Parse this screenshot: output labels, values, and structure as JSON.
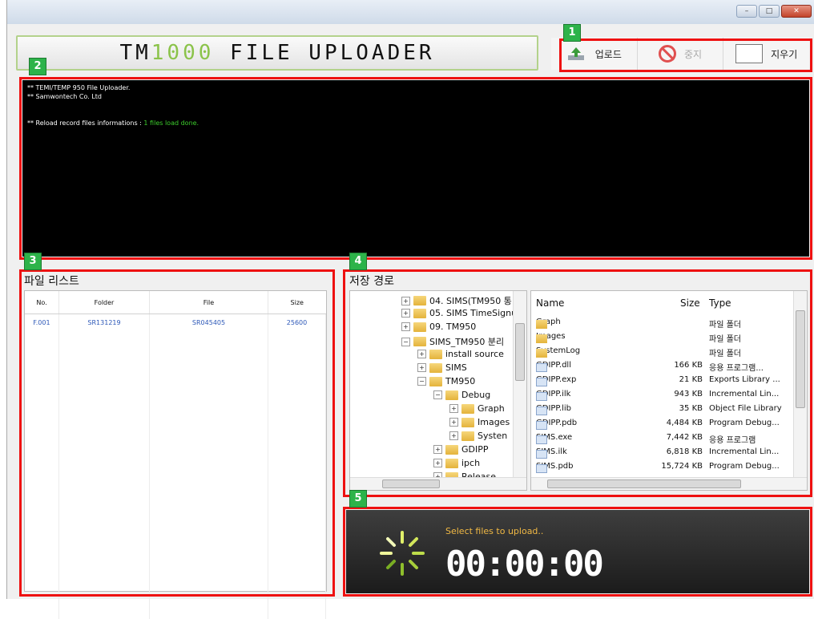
{
  "window": {
    "min": "–",
    "max": "□",
    "close": "✕"
  },
  "logo": {
    "part1": "TM",
    "part2": "1000",
    "part3": " FILE UPLOADER"
  },
  "toolbar": {
    "upload": "업로드",
    "stop": "중지",
    "clear": "지우기"
  },
  "badges": [
    "1",
    "2",
    "3",
    "4",
    "5"
  ],
  "console": {
    "line1": "** TEMI/TEMP 950 File Uploader.",
    "line2": "** Samwontech Co. Ltd",
    "line3_prefix": "** Reload record files informations : ",
    "line3_status": "1 files load done."
  },
  "filelist": {
    "title": "파일 리스트",
    "columns": [
      "No.",
      "Folder",
      "File",
      "Size"
    ],
    "rows": [
      [
        "F.001",
        "SR131219",
        "SR045405",
        "25600"
      ]
    ]
  },
  "save_path": {
    "title": "저장 경로",
    "tree": [
      "04. SIMS(TM950 통",
      "05. SIMS TimeSignu",
      "09. TM950",
      "SIMS_TM950 분리",
      "install source",
      "SIMS",
      "TM950",
      "Debug",
      "Graph",
      "Images",
      "Systen",
      "GDIPP",
      "ipch",
      "Release"
    ],
    "file_headers": {
      "name": "Name",
      "size": "Size",
      "type": "Type"
    },
    "files": [
      {
        "name": "Graph",
        "size": "",
        "type": "파일 폴더",
        "folder": true
      },
      {
        "name": "Images",
        "size": "",
        "type": "파일 폴더",
        "folder": true
      },
      {
        "name": "SystemLog",
        "size": "",
        "type": "파일 폴더",
        "folder": true
      },
      {
        "name": "GDIPP.dll",
        "size": "166 KB",
        "type": "응용 프로그램...",
        "folder": false
      },
      {
        "name": "GDIPP.exp",
        "size": "21 KB",
        "type": "Exports Library ...",
        "folder": false
      },
      {
        "name": "GDIPP.ilk",
        "size": "943 KB",
        "type": "Incremental Lin...",
        "folder": false
      },
      {
        "name": "GDIPP.lib",
        "size": "35 KB",
        "type": "Object File Library",
        "folder": false
      },
      {
        "name": "GDIPP.pdb",
        "size": "4,484 KB",
        "type": "Program Debug...",
        "folder": false
      },
      {
        "name": "SIMS.exe",
        "size": "7,442 KB",
        "type": "응용 프로그램",
        "folder": false
      },
      {
        "name": "SIMS.ilk",
        "size": "6,818 KB",
        "type": "Incremental Lin...",
        "folder": false
      },
      {
        "name": "SIMS.pdb",
        "size": "15,724 KB",
        "type": "Program Debug...",
        "folder": false
      }
    ]
  },
  "timer": {
    "message": "Select files to upload..",
    "time": "00:00:00"
  }
}
